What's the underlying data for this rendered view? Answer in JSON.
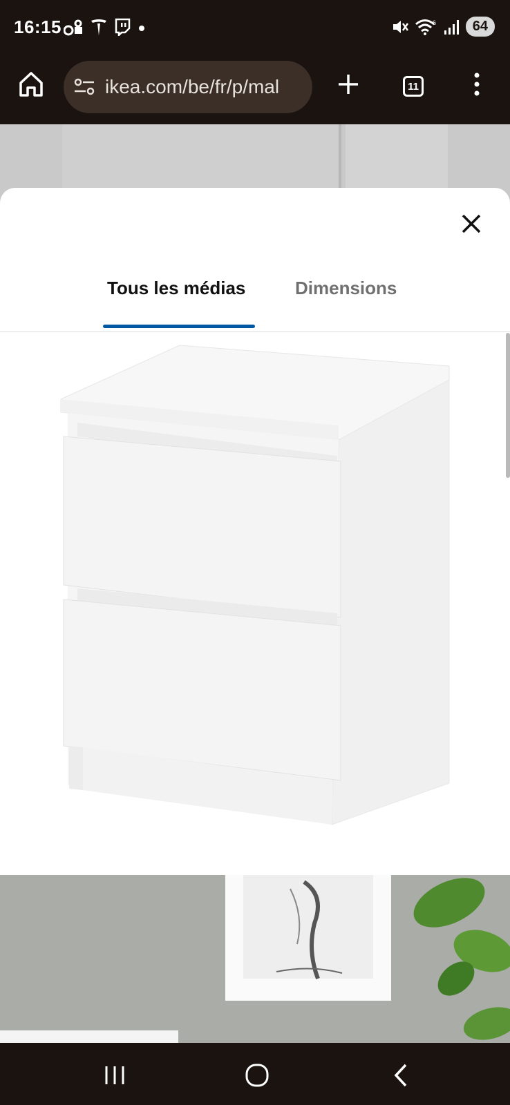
{
  "status_bar": {
    "time": "16:15",
    "battery": "64",
    "left_icons": [
      "bike-lock-icon",
      "tesla-icon",
      "twitch-icon",
      "dot-icon"
    ],
    "right_icons": [
      "mute-icon",
      "wifi-icon",
      "signal-icon",
      "battery-icon"
    ]
  },
  "browser": {
    "url": "ikea.com/be/fr/p/mal",
    "tab_count": "11",
    "icons": [
      "home-icon",
      "site-settings-icon",
      "new-tab-icon",
      "tab-switcher-icon",
      "more-menu-icon"
    ]
  },
  "modal": {
    "tabs": [
      {
        "label": "Tous les médias",
        "active": true
      },
      {
        "label": "Dimensions",
        "active": false
      }
    ]
  },
  "colors": {
    "accent": "#0058a3",
    "system_bar": "#1b130f",
    "url_pill": "#3b2f28"
  }
}
